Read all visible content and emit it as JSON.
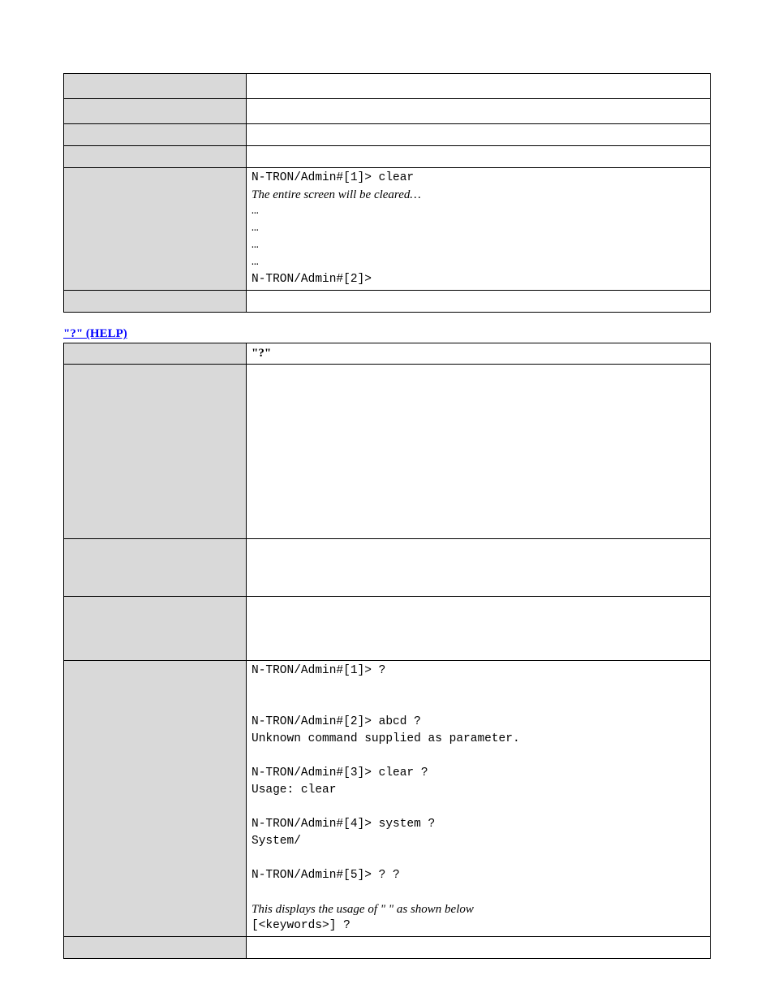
{
  "table1": {
    "example_lines": [
      {
        "text": "N-TRON/Admin#[1]> clear",
        "cls": "mono"
      },
      {
        "text": "The entire screen will be cleared…",
        "cls": "italic"
      },
      {
        "text": "…",
        "cls": "mono"
      },
      {
        "text": "…",
        "cls": "mono"
      },
      {
        "text": "…",
        "cls": "mono"
      },
      {
        "text": "…",
        "cls": "mono"
      },
      {
        "text": "N-TRON/Admin#[2]>",
        "cls": "mono"
      }
    ]
  },
  "heading2": "\"?\" (HELP)",
  "table2": {
    "command_name": "\"?\"",
    "example_lines": [
      {
        "text": "N-TRON/Admin#[1]> ?",
        "cls": "mono"
      },
      {
        "text": "",
        "cls": "mono"
      },
      {
        "text": "",
        "cls": "mono"
      },
      {
        "text": "N-TRON/Admin#[2]> abcd ?",
        "cls": "mono"
      },
      {
        "text": "Unknown command supplied as parameter.",
        "cls": "mono"
      },
      {
        "text": "",
        "cls": "mono"
      },
      {
        "text": "N-TRON/Admin#[3]> clear ?",
        "cls": "mono"
      },
      {
        "text": "Usage:  clear",
        "cls": "mono"
      },
      {
        "text": "",
        "cls": "mono"
      },
      {
        "text": "N-TRON/Admin#[4]> system ?",
        "cls": "mono"
      },
      {
        "text": "System/",
        "cls": "mono"
      },
      {
        "text": "",
        "cls": "mono"
      },
      {
        "text": "N-TRON/Admin#[5]> ? ?",
        "cls": "mono"
      },
      {
        "text": "",
        "cls": "mono"
      },
      {
        "text": "This displays the usage of \"  \" as shown below",
        "cls": "italic"
      },
      {
        "text": "[<keywords>] ?",
        "cls": "mono"
      }
    ]
  }
}
